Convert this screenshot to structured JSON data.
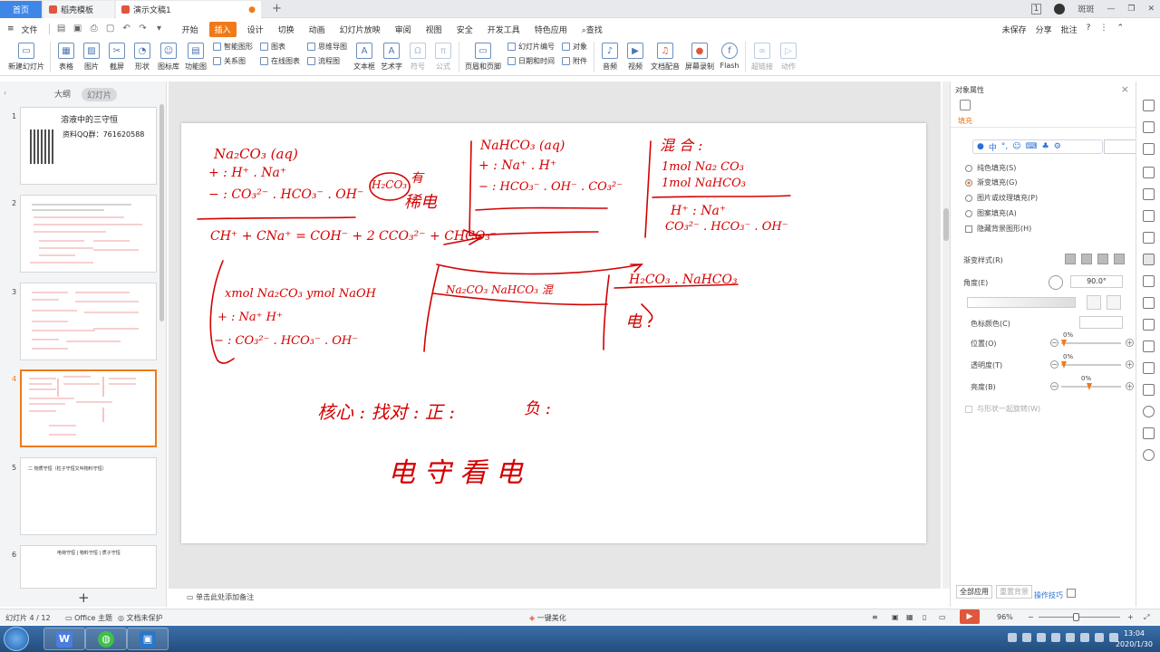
{
  "tabs": {
    "home": "首页",
    "template": "稻壳模板",
    "doc": "演示文稿1"
  },
  "titlebar": {
    "page_badge": "1",
    "user": "斑斑"
  },
  "menu": {
    "file": "文件",
    "items": [
      "开始",
      "插入",
      "设计",
      "切换",
      "动画",
      "幻灯片放映",
      "审阅",
      "视图",
      "安全",
      "开发工具",
      "特色应用"
    ],
    "active": "插入",
    "search": "查找",
    "unsaved": "未保存",
    "share": "分享",
    "comment": "批注"
  },
  "ribbon": {
    "new_slide": "新建幻灯片",
    "table": "表格",
    "picture": "图片",
    "screenshot": "截屏",
    "shape": "形状",
    "icon_lib": "图标库",
    "func_chart": "功能图",
    "smart_shape": "智能图形",
    "relation": "关系图",
    "chart": "图表",
    "online_chart": "在线图表",
    "mindmap": "思维导图",
    "flowchart": "流程图",
    "textbox": "文本框",
    "art_text": "艺术字",
    "symbol": "符号",
    "formula": "公式",
    "header_footer": "页眉和页脚",
    "slide_num": "幻灯片编号",
    "datetime": "日期和时间",
    "object": "对象",
    "attachment": "附件",
    "audio": "音频",
    "video": "视频",
    "text_dub": "文档配音",
    "screen_rec": "屏幕录制",
    "flash": "Flash",
    "hyperlink": "超链接",
    "action": "动作"
  },
  "leftpane": {
    "outline": "大纲",
    "slides": "幻灯片",
    "thumb1_title": "溶液中的三守恒",
    "thumb1_sub": "资料QQ群：761620588",
    "thumb5_text": "二 物质守恒（粒子守恒又叫物料守恒）",
    "thumb6_text": "电荷守恒 | 物料守恒 | 质子守恒",
    "numbers": [
      "1",
      "2",
      "3",
      "4",
      "5",
      "6"
    ]
  },
  "handwriting": {
    "l1": "Na₂CO₃ (aq)",
    "l2": "+ : H⁺ . Na⁺",
    "l3": "− : CO₃²⁻ . HCO₃⁻ . OH⁻",
    "l4": "CH⁺ + CNa⁺ = COH⁻ + 2 CCO₃²⁻ + CHCO₃⁻",
    "h2co3": "H₂CO₃",
    "you": "有",
    "weak": "稀电",
    "m1": "NaHCO₃ (aq)",
    "m2": "+ : Na⁺ . H⁺",
    "m3": "− : HCO₃⁻ . OH⁻ . CO₃²⁻",
    "r1": "混 合 :",
    "r2": "1mol  Na₂ CO₃",
    "r3": "1mol  NaHCO₃",
    "r4": "H⁺ :  Na⁺",
    "r5": "CO₃²⁻ . HCO₃⁻ . OH⁻",
    "b1": "xmol Na₂CO₃  ymol NaOH",
    "b2": "+ :  Na⁺ H⁺",
    "b3": "− : CO₃²⁻ . HCO₃⁻ . OH⁻",
    "c1": "Na₂CO₃   NaHCO₃ 混",
    "d1": "H₂CO₃ . NaHCO₃",
    "d2": "电 :",
    "core": "核心 : 找对 : 正 :",
    "neg": "负 :",
    "big": "电 守 看 电"
  },
  "notes_placeholder": "单击此处添加备注",
  "rightpane": {
    "title": "对象属性",
    "fill": "填充",
    "options": [
      "纯色填充(S)",
      "渐变填充(G)",
      "图片或纹理填充(P)",
      "图案填充(A)"
    ],
    "selected_option": 1,
    "hide_bg": "隐藏背景图形(H)",
    "grad_style": "渐变样式(R)",
    "angle_label": "角度(E)",
    "angle_value": "90.0°",
    "stop_color": "色标颜色(C)",
    "position": "位置(O)",
    "transparency": "透明度(T)",
    "brightness": "亮度(B)",
    "pct": "0%",
    "rotate_with_shape": "与形状一起旋转(W)",
    "apply_all": "全部应用",
    "reset_bg": "重置背景",
    "tips": "操作技巧"
  },
  "status": {
    "slide": "幻灯片 4 / 12",
    "theme": "Office 主题",
    "protect": "文档未保护",
    "beautify": "一键美化",
    "zoom": "96%"
  },
  "taskbar": {
    "time": "13:04",
    "date": "2020/1/30"
  }
}
